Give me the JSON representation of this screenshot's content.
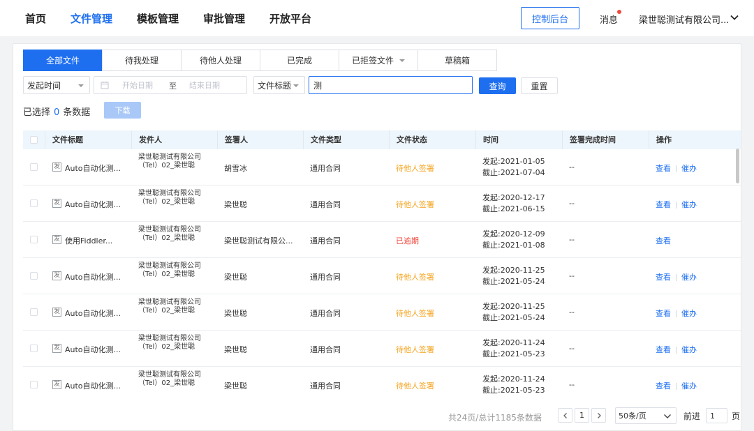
{
  "nav": {
    "items": [
      {
        "label": "首页",
        "active": false
      },
      {
        "label": "文件管理",
        "active": true
      },
      {
        "label": "模板管理",
        "active": false
      },
      {
        "label": "审批管理",
        "active": false
      },
      {
        "label": "开放平台",
        "active": false
      }
    ],
    "console_label": "控制后台",
    "messages_label": "消息",
    "company": "梁世聪测试有限公司..."
  },
  "tabs": [
    {
      "label": "全部文件",
      "active": true,
      "dropdown": false
    },
    {
      "label": "待我处理",
      "active": false,
      "dropdown": false
    },
    {
      "label": "待他人处理",
      "active": false,
      "dropdown": false
    },
    {
      "label": "已完成",
      "active": false,
      "dropdown": false
    },
    {
      "label": "已拒签文件",
      "active": false,
      "dropdown": true
    },
    {
      "label": "草稿箱",
      "active": false,
      "dropdown": false
    }
  ],
  "filters": {
    "time_field": "发起时间",
    "start_placeholder": "开始日期",
    "range_sep": "至",
    "end_placeholder": "结束日期",
    "search_field": "文件标题",
    "search_value": "测",
    "query_label": "查询",
    "reset_label": "重置"
  },
  "selection": {
    "prefix": "已选择",
    "count": "0",
    "suffix": "条数据",
    "download_label": "下载"
  },
  "table": {
    "headers": [
      "文件标题",
      "发件人",
      "签署人",
      "文件类型",
      "文件状态",
      "时间",
      "签署完成时间",
      "操作"
    ],
    "rows": [
      {
        "tag": "发",
        "title": "Auto自动化测...",
        "sender": "梁世聪测试有限公司（Tel）02_梁世聪",
        "signer": "胡雪冰",
        "type": "通用合同",
        "status": "待他人签署",
        "status_kind": "pending",
        "start": "发起:2021-01-05",
        "end": "截止:2021-07-04",
        "done": "--",
        "ops": [
          "查看",
          "催办"
        ]
      },
      {
        "tag": "发",
        "title": "Auto自动化测...",
        "sender": "梁世聪测试有限公司（Tel）02_梁世聪",
        "signer": "梁世聪",
        "type": "通用合同",
        "status": "待他人签署",
        "status_kind": "pending",
        "start": "发起:2020-12-17",
        "end": "截止:2021-06-15",
        "done": "--",
        "ops": [
          "查看",
          "催办"
        ]
      },
      {
        "tag": "发",
        "title": "使用Fiddler...",
        "sender": "梁世聪测试有限公司（Tel）02_梁世聪",
        "signer": "梁世聪测试有限公...",
        "type": "通用合同",
        "status": "已逾期",
        "status_kind": "overdue",
        "start": "发起:2020-12-09",
        "end": "截止:2021-01-08",
        "done": "--",
        "ops": [
          "查看"
        ]
      },
      {
        "tag": "发",
        "title": "Auto自动化测...",
        "sender": "梁世聪测试有限公司（Tel）02_梁世聪",
        "signer": "梁世聪",
        "type": "通用合同",
        "status": "待他人签署",
        "status_kind": "pending",
        "start": "发起:2020-11-25",
        "end": "截止:2021-05-24",
        "done": "--",
        "ops": [
          "查看",
          "催办"
        ]
      },
      {
        "tag": "发",
        "title": "Auto自动化测...",
        "sender": "梁世聪测试有限公司（Tel）02_梁世聪",
        "signer": "梁世聪",
        "type": "通用合同",
        "status": "待他人签署",
        "status_kind": "pending",
        "start": "发起:2020-11-25",
        "end": "截止:2021-05-24",
        "done": "--",
        "ops": [
          "查看",
          "催办"
        ]
      },
      {
        "tag": "发",
        "title": "Auto自动化测...",
        "sender": "梁世聪测试有限公司（Tel）02_梁世聪",
        "signer": "梁世聪",
        "type": "通用合同",
        "status": "待他人签署",
        "status_kind": "pending",
        "start": "发起:2020-11-24",
        "end": "截止:2021-05-23",
        "done": "--",
        "ops": [
          "查看",
          "催办"
        ]
      },
      {
        "tag": "发",
        "title": "Auto自动化测...",
        "sender": "梁世聪测试有限公司（Tel）02_梁世聪",
        "signer": "梁世聪",
        "type": "通用合同",
        "status": "待他人签署",
        "status_kind": "pending",
        "start": "发起:2020-11-24",
        "end": "截止:2021-05-23",
        "done": "--",
        "ops": [
          "查看",
          "催办"
        ]
      }
    ]
  },
  "pagination": {
    "summary": "共24页/总计1185条数据",
    "current_page": "1",
    "page_size": "50条/页",
    "goto_label": "前进",
    "goto_value": "1",
    "goto_suffix": "页"
  },
  "colors": {
    "accent": "#1e6ff0",
    "pending": "#f5a623",
    "overdue": "#f0493e",
    "header_bg": "#eef6fd"
  },
  "icons": [
    "calendar-icon",
    "chevron-down-icon",
    "chevron-left-icon",
    "chevron-right-icon",
    "caret-down-icon",
    "notification-dot-icon",
    "checkbox-icon",
    "file-tag-icon"
  ]
}
